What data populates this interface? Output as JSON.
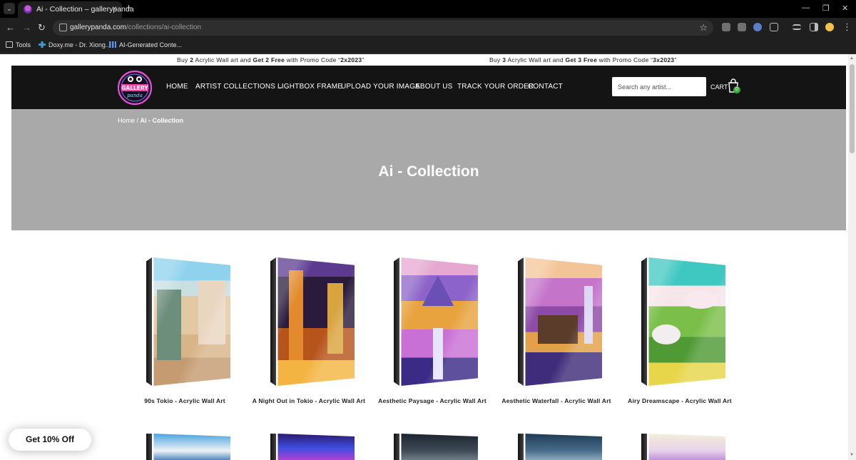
{
  "browser": {
    "tab_title": "Ai - Collection – gallerypanda",
    "url_host": "gallerypanda.com",
    "url_path": "/collections/ai-collection",
    "bookmarks": [
      "Tools",
      "Doxy.me - Dr. Xiong...",
      "AI-Generated Conte..."
    ]
  },
  "promo": {
    "left": {
      "pre": "Buy ",
      "n1": "2",
      "mid1": " Acrylic Wall art and ",
      "get": "Get 2 Free",
      "mid2": " with Promo Code “",
      "code": "2x2023",
      "end": "”"
    },
    "right": {
      "pre": "Buy ",
      "n1": "3",
      "mid1": " Acrylic Wall art and ",
      "get": "Get 3 Free",
      "mid2": " with Promo Code “",
      "code": "3x2023",
      "end": "”"
    }
  },
  "header": {
    "logo_text": "GALLERY panda",
    "nav": [
      "HOME",
      "ARTIST COLLECTIONS",
      "LIGHTBOX FRAME",
      "UPLOAD YOUR IMAGE",
      "ABOUT US",
      "TRACK YOUR ORDER",
      "CONTACT"
    ],
    "search_placeholder": "Search any artist...",
    "cart_label": "CART",
    "cart_count": "0"
  },
  "hero": {
    "breadcrumb_home": "Home",
    "breadcrumb_sep": " / ",
    "breadcrumb_current": "Ai - Collection",
    "title": "Ai - Collection"
  },
  "products": [
    {
      "title": "90s Tokio - Acrylic Wall Art"
    },
    {
      "title": "A Night Out in Tokio - Acrylic Wall Art"
    },
    {
      "title": "Aesthetic Paysage - Acrylic Wall Art"
    },
    {
      "title": "Aesthetic Waterfall - Acrylic Wall Art"
    },
    {
      "title": "Airy Dreamscape - Acrylic Wall Art"
    }
  ],
  "popup": {
    "label": "Get 10% Off"
  },
  "colors": {
    "header_bg": "#141414",
    "hero_bg": "#a9a9a9",
    "badge": "#3caa3c"
  }
}
